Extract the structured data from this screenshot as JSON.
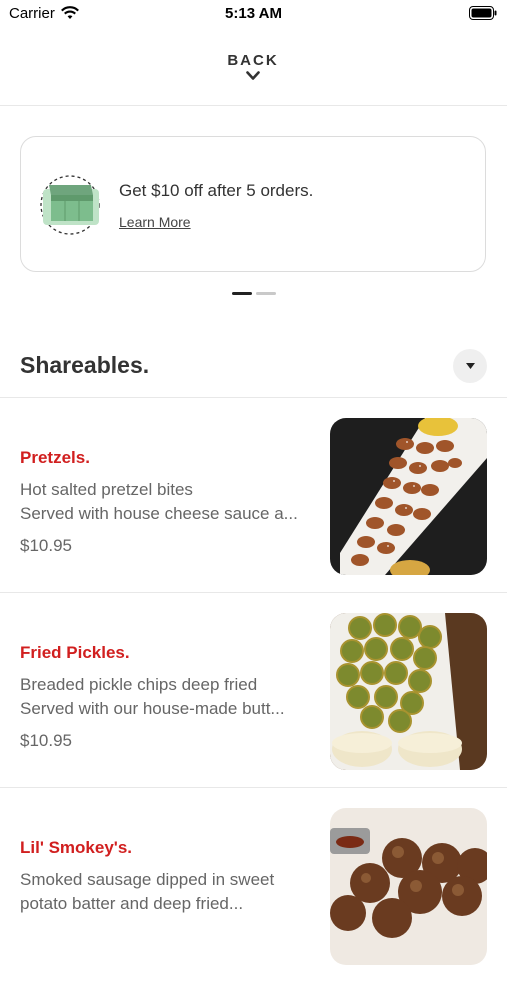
{
  "status_bar": {
    "carrier": "Carrier",
    "time": "5:13 AM"
  },
  "nav": {
    "back_label": "BACK"
  },
  "promo": {
    "text": "Get $10 off after 5 orders.",
    "link_label": "Learn More",
    "icon": "box-icon",
    "pages": 2,
    "active_page": 1
  },
  "section": {
    "title": "Shareables.",
    "toggle_icon": "triangle-down-icon"
  },
  "items": [
    {
      "name": "Pretzels.",
      "description_line1": "Hot salted pretzel bites",
      "description_line2": "Served with house cheese sauce a...",
      "price": "$10.95",
      "image": "pretzel-bites-photo"
    },
    {
      "name": "Fried Pickles.",
      "description_line1": "Breaded pickle chips deep fried",
      "description_line2": "Served with our house-made butt...",
      "price": "$10.95",
      "image": "fried-pickles-photo"
    },
    {
      "name": "Lil' Smokey's.",
      "description_line1": "Smoked sausage dipped in sweet",
      "description_line2": "potato batter and deep fried...",
      "price": "",
      "image": "lil-smokeys-photo"
    }
  ],
  "colors": {
    "item_name": "#d11f1f",
    "text": "#333333",
    "muted": "#666666",
    "promo_green": "#7dbd8d"
  }
}
